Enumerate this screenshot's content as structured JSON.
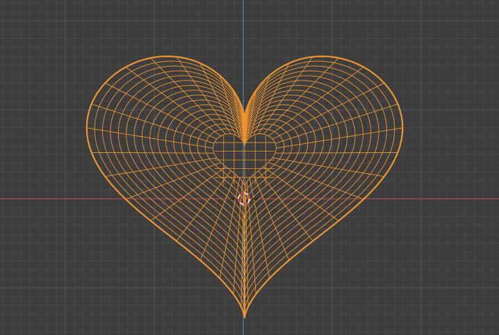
{
  "viewport": {
    "background_color": "#3d3d3d",
    "grid_minor_color": "#474747",
    "grid_major_color": "#525252",
    "x_axis_color": "#a04a4e",
    "y_axis_color": "#4f7cc0"
  },
  "object": {
    "type": "heart-mesh",
    "display": "wireframe",
    "selected": true,
    "wire_color": "#f0952e"
  },
  "cursor_3d": {
    "icon": "crosshair-target-icon",
    "ring_colors": [
      "#d6d6d6",
      "#c24a4a"
    ]
  }
}
